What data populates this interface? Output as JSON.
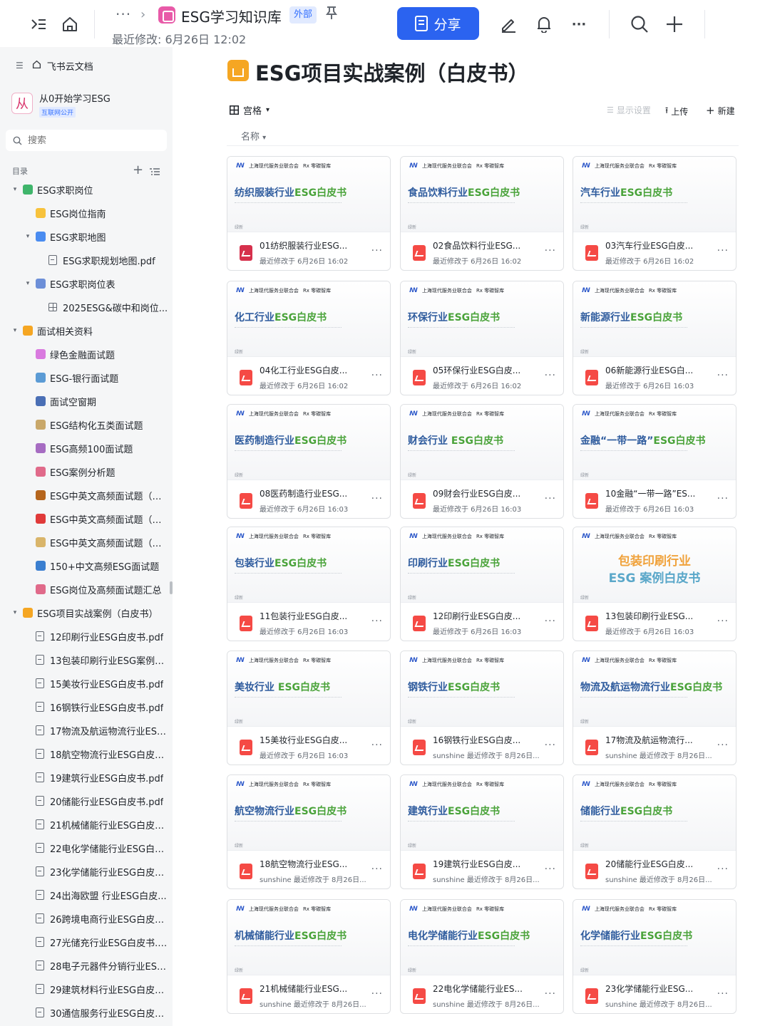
{
  "topbar": {
    "crumb_dots": "···",
    "crumb_arrow": "›",
    "wiki_title": "ESG学习知识库",
    "wiki_tag": "外部",
    "last_modified": "最近修改: 6月26日 12:02",
    "share_label": "分享",
    "more_label": "···"
  },
  "sidebar": {
    "home_label": "飞书云文档",
    "space_avatar": "从",
    "space_name": "从0开始学习ESG",
    "space_badge": "互联网公开",
    "search_placeholder": "搜索",
    "toc_label": "目录",
    "items": [
      {
        "label": "ESG求职岗位",
        "level": 0,
        "caret": "▾",
        "icon": "#3fb56b"
      },
      {
        "label": "ESG岗位指南",
        "level": 1,
        "caret": "",
        "icon": "#f7c23c"
      },
      {
        "label": "ESG求职地图",
        "level": 1,
        "caret": "▾",
        "icon": "#4a8cf0"
      },
      {
        "label": "ESG求职规划地图.pdf",
        "level": 2,
        "caret": "",
        "icon": "pdf"
      },
      {
        "label": "ESG求职岗位表",
        "level": 1,
        "caret": "▾",
        "icon": "#6d8fd8"
      },
      {
        "label": "2025ESG&碳中和岗位...",
        "level": 2,
        "caret": "",
        "icon": "grid"
      },
      {
        "label": "面试相关资料",
        "level": 0,
        "caret": "▾",
        "icon": "#f5a623"
      },
      {
        "label": "绿色金融面试题",
        "level": 1,
        "caret": "",
        "icon": "#d97adf"
      },
      {
        "label": "ESG-银行面试题",
        "level": 1,
        "caret": "",
        "icon": "#5b9bd5"
      },
      {
        "label": "面试空窗期",
        "level": 1,
        "caret": "",
        "icon": "#4a6fb5"
      },
      {
        "label": "ESG结构化五类面试题",
        "level": 1,
        "caret": "",
        "icon": "#c9a86a"
      },
      {
        "label": "ESG高频100面试题",
        "level": 1,
        "caret": "",
        "icon": "#a66cc2"
      },
      {
        "label": "ESG案例分析题",
        "level": 1,
        "caret": "",
        "icon": "#e06a8a"
      },
      {
        "label": "ESG中英文高频面试题（中...",
        "level": 1,
        "caret": "",
        "icon": "#b5651d"
      },
      {
        "label": "ESG中英文高频面试题（英...",
        "level": 1,
        "caret": "",
        "icon": "#e03a3a"
      },
      {
        "label": "ESG中英文高频面试题（全...",
        "level": 1,
        "caret": "",
        "icon": "#d9b56a"
      },
      {
        "label": "150+中文高频ESG面试题",
        "level": 1,
        "caret": "",
        "icon": "#3b7fd0"
      },
      {
        "label": "ESG岗位及高频面试题汇总",
        "level": 1,
        "caret": "",
        "icon": "#e06a8a"
      },
      {
        "label": "ESG项目实战案例（白皮书）",
        "level": 0,
        "caret": "▾",
        "icon": "#f5a623"
      },
      {
        "label": "12印刷行业ESG白皮书.pdf",
        "level": 1,
        "caret": "",
        "icon": "pdf"
      },
      {
        "label": "13包装印刷行业ESG案例白...",
        "level": 1,
        "caret": "",
        "icon": "pdf"
      },
      {
        "label": "15美妆行业ESG白皮书.pdf",
        "level": 1,
        "caret": "",
        "icon": "pdf"
      },
      {
        "label": "16钢铁行业ESG白皮书.pdf",
        "level": 1,
        "caret": "",
        "icon": "pdf"
      },
      {
        "label": "17物流及航运物流行业ESG...",
        "level": 1,
        "caret": "",
        "icon": "pdf"
      },
      {
        "label": "18航空物流行业ESG白皮书...",
        "level": 1,
        "caret": "",
        "icon": "pdf"
      },
      {
        "label": "19建筑行业ESG白皮书.pdf",
        "level": 1,
        "caret": "",
        "icon": "pdf"
      },
      {
        "label": "20储能行业ESG白皮书.pdf",
        "level": 1,
        "caret": "",
        "icon": "pdf"
      },
      {
        "label": "21机械储能行业ESG白皮书...",
        "level": 1,
        "caret": "",
        "icon": "pdf"
      },
      {
        "label": "22电化学储能行业ESG白皮...",
        "level": 1,
        "caret": "",
        "icon": "pdf"
      },
      {
        "label": "23化学储能行业ESG白皮书...",
        "level": 1,
        "caret": "",
        "icon": "pdf"
      },
      {
        "label": "24出海欧盟 行业ESG白皮...",
        "level": 1,
        "caret": "",
        "icon": "pdf"
      },
      {
        "label": "26跨境电商行业ESG白皮书...",
        "level": 1,
        "caret": "",
        "icon": "pdf"
      },
      {
        "label": "27光储充行业ESG白皮书.pdf",
        "level": 1,
        "caret": "",
        "icon": "pdf"
      },
      {
        "label": "28电子元器件分销行业ESG...",
        "level": 1,
        "caret": "",
        "icon": "pdf"
      },
      {
        "label": "29建筑材料行业ESG白皮书...",
        "level": 1,
        "caret": "",
        "icon": "pdf"
      },
      {
        "label": "30通信服务行业ESG白皮书...",
        "level": 1,
        "caret": "",
        "icon": "pdf"
      }
    ]
  },
  "main": {
    "title": "ESG项目实战案例（白皮书）",
    "view_label": "宫格",
    "sort_label": "名称",
    "display_settings": "显示设置",
    "upload": "上传",
    "new": "新建",
    "cover_brand": "Rx 零碳智库",
    "cover_org": "上海现代服务业联合会",
    "cover_tag": "绿新",
    "more": "···",
    "cards": [
      {
        "cover_a": "纺织服装行业",
        "cover_b": "ESG白皮书",
        "cover_color": "#2f5c9e",
        "name": "01纺织服装行业ESG...",
        "meta": "最近修改于 6月26日 16:02",
        "pdf": "red"
      },
      {
        "cover_a": "食品饮料行业",
        "cover_b": "ESG白皮书",
        "cover_color": "#2f5c9e",
        "name": "02食品饮料行业ESG...",
        "meta": "最近修改于 6月26日 16:02",
        "pdf": ""
      },
      {
        "cover_a": "汽车行业",
        "cover_b": "ESG白皮书",
        "cover_color": "#2f5c9e",
        "name": "03汽车行业ESG白皮...",
        "meta": "最近修改于 6月26日 16:02",
        "pdf": ""
      },
      {
        "cover_a": "化工行业",
        "cover_b": "ESG白皮书",
        "cover_color": "#2f5c9e",
        "name": "04化工行业ESG白皮...",
        "meta": "最近修改于 6月26日 16:02",
        "pdf": ""
      },
      {
        "cover_a": "环保行业",
        "cover_b": "ESG白皮书",
        "cover_color": "#2f5c9e",
        "name": "05环保行业ESG白皮...",
        "meta": "最近修改于 6月26日 16:02",
        "pdf": ""
      },
      {
        "cover_a": "新能源行业",
        "cover_b": "ESG白皮书",
        "cover_color": "#2f5c9e",
        "name": "06新能源行业ESG白...",
        "meta": "最近修改于 6月26日 16:03",
        "pdf": ""
      },
      {
        "cover_a": "医药制造行业",
        "cover_b": "ESG白皮书",
        "cover_color": "#2f5c9e",
        "name": "08医药制造行业ESG...",
        "meta": "最近修改于 6月26日 16:03",
        "pdf": ""
      },
      {
        "cover_a": "财会行业",
        "cover_b": " ESG白皮书",
        "cover_color": "#2f5c9e",
        "name": "09财会行业ESG白皮...",
        "meta": "最近修改于 6月26日 16:03",
        "pdf": ""
      },
      {
        "cover_a": "金融“一带一路”",
        "cover_b": "ESG白皮书",
        "cover_color": "#2f5c9e",
        "name": "10金融“一带一路”ES...",
        "meta": "最近修改于 6月26日 16:03",
        "pdf": ""
      },
      {
        "cover_a": "包装行业",
        "cover_b": "ESG白皮书",
        "cover_color": "#2f5c9e",
        "name": "11包装行业ESG白皮...",
        "meta": "最近修改于 6月26日 16:03",
        "pdf": ""
      },
      {
        "cover_a": "印刷行业",
        "cover_b": "ESG白皮书",
        "cover_color": "#2f5c9e",
        "name": "12印刷行业ESG白皮...",
        "meta": "最近修改于 6月26日 16:03",
        "pdf": ""
      },
      {
        "cover_a": "包装印刷行业",
        "cover_b": "ESG 案例白皮书",
        "cover_color": "special",
        "name": "13包装印刷行业ESG...",
        "meta": "最近修改于 6月26日 16:03",
        "pdf": ""
      },
      {
        "cover_a": "美妆行业",
        "cover_b": " ESG白皮书",
        "cover_color": "#2f5c9e",
        "name": "15美妆行业ESG白皮...",
        "meta": "最近修改于 6月26日 16:03",
        "pdf": ""
      },
      {
        "cover_a": "钢铁行业",
        "cover_b": "ESG白皮书",
        "cover_color": "#2f5c9e",
        "name": "16钢铁行业ESG白皮...",
        "meta": "sunshine 最近修改于 8月26日...",
        "pdf": ""
      },
      {
        "cover_a": "物流及航运物流行业",
        "cover_b": "ESG白皮书",
        "cover_color": "#2f5c9e",
        "name": "17物流及航运物流行...",
        "meta": "sunshine 最近修改于 8月26日...",
        "pdf": ""
      },
      {
        "cover_a": "航空物流行业",
        "cover_b": "ESG白皮书",
        "cover_color": "#2f5c9e",
        "name": "18航空物流行业ESG...",
        "meta": "sunshine 最近修改于 8月26日...",
        "pdf": ""
      },
      {
        "cover_a": "建筑行业",
        "cover_b": "ESG白皮书",
        "cover_color": "#2f5c9e",
        "name": "19建筑行业ESG白皮...",
        "meta": "sunshine 最近修改于 8月26日...",
        "pdf": ""
      },
      {
        "cover_a": "储能行业",
        "cover_b": "ESG白皮书",
        "cover_color": "#2f5c9e",
        "name": "20储能行业ESG白皮...",
        "meta": "sunshine 最近修改于 8月26日...",
        "pdf": ""
      },
      {
        "cover_a": "机械储能行业",
        "cover_b": "ESG白皮书",
        "cover_color": "#2f5c9e",
        "name": "21机械储能行业ESG...",
        "meta": "sunshine 最近修改于 8月26日...",
        "pdf": ""
      },
      {
        "cover_a": "电化学储能行业",
        "cover_b": "ESG白皮书",
        "cover_color": "#2f5c9e",
        "name": "22电化学储能行业ES...",
        "meta": "sunshine 最近修改于 8月26日...",
        "pdf": ""
      },
      {
        "cover_a": "化学储能行业",
        "cover_b": "ESG白皮书",
        "cover_color": "#2f5c9e",
        "name": "23化学储能行业ESG...",
        "meta": "sunshine 最近修改于 8月26日...",
        "pdf": ""
      }
    ]
  }
}
